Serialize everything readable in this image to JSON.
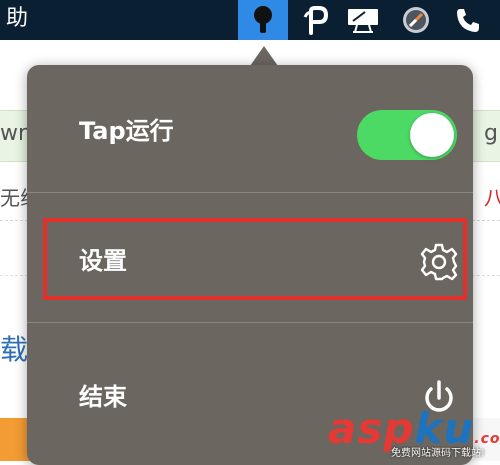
{
  "menubar": {
    "app_title": "助",
    "icons": [
      "keyhole-icon",
      "p-app-icon",
      "display-icon",
      "compass-icon",
      "phone-icon"
    ]
  },
  "background": {
    "row1_text": "wr",
    "row1_right": "g",
    "row2_text": "无线",
    "row2_right": "八",
    "row3_text": "载"
  },
  "menu": {
    "items": [
      {
        "label": "Tap运行",
        "control": "toggle",
        "on": true
      },
      {
        "label": "设置",
        "icon": "gear-icon",
        "highlighted": true
      },
      {
        "label": "结束",
        "icon": "power-icon"
      }
    ]
  },
  "colors": {
    "menubar_bg": "#0b1f33",
    "active_icon_bg": "#2f8ae6",
    "popover_bg": "#6b665f",
    "toggle_on": "#4cd964",
    "highlight_border": "#e2312c"
  },
  "watermark": {
    "main_a": "asp",
    "main_b": "ku",
    "suffix": ".com",
    "sub": "免费网站源码下载站!"
  }
}
